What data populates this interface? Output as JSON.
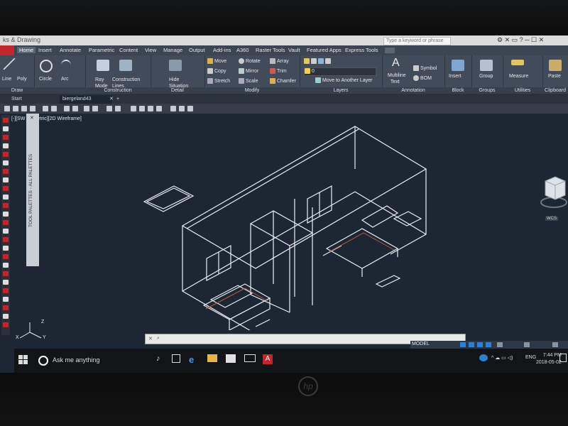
{
  "app": {
    "title": "ks & Drawing",
    "search_placeholder": "Type a keyword or phrase",
    "colors": {
      "ribbon": "#414b59",
      "viewport": "#1d2733",
      "accent": "#2d7fd1",
      "red_logo": "#c3272b"
    }
  },
  "ribbon_tabs": [
    "Home",
    "Insert",
    "Annotate",
    "Parametric",
    "Content",
    "View",
    "Manage",
    "Output",
    "Add-ins",
    "A360",
    "Raster Tools",
    "Vault",
    "Featured Apps",
    "Express Tools"
  ],
  "panels": {
    "draw": {
      "label": "Draw",
      "tools": [
        "Line",
        "Poly",
        "Circle",
        "Arc"
      ]
    },
    "construction": {
      "label": "Construction",
      "tools": [
        "Ray",
        "Mode",
        "Construction",
        "Lines"
      ]
    },
    "detail": {
      "label": "Detail",
      "tools": [
        "Hide",
        "Situation"
      ]
    },
    "modify": {
      "label": "Modify",
      "tools": [
        "Move",
        "Rotate",
        "Array",
        "Copy",
        "Mirror",
        "Trim",
        "Stretch",
        "Scale",
        "Chamfer"
      ]
    },
    "layers": {
      "label": "Layers",
      "layer_value": "0",
      "move_layer": "Move to Another Layer"
    },
    "annotation": {
      "label": "Annotation",
      "tools": [
        "Multiline",
        "Text",
        "Symbol",
        "BOM"
      ]
    },
    "block": {
      "label": "Block",
      "tools": [
        "Insert"
      ]
    },
    "groups": {
      "label": "Groups",
      "tools": [
        "Group"
      ]
    },
    "utilities": {
      "label": "Utilities",
      "tools": [
        "Measure"
      ]
    },
    "clipboard": {
      "label": "Clipboard",
      "tools": [
        "Paste"
      ]
    }
  },
  "doc_tabs": [
    "Start",
    "biergeland43"
  ],
  "viewport_label": "[-][SW Isometric][2D Wireframe]",
  "palette_title": "TOOL PALETTES - ALL PALETTES",
  "viewcube": {
    "wcs": "WCS"
  },
  "ucs": {
    "x": "X",
    "y": "Y",
    "z": "Z"
  },
  "statusbar": {
    "model": "MODEL"
  },
  "taskbar": {
    "search_text": "Ask me anything",
    "time": "7:44 PM",
    "date": "2018-05-02",
    "lang": "ENG"
  },
  "laptop_brand": "hp"
}
